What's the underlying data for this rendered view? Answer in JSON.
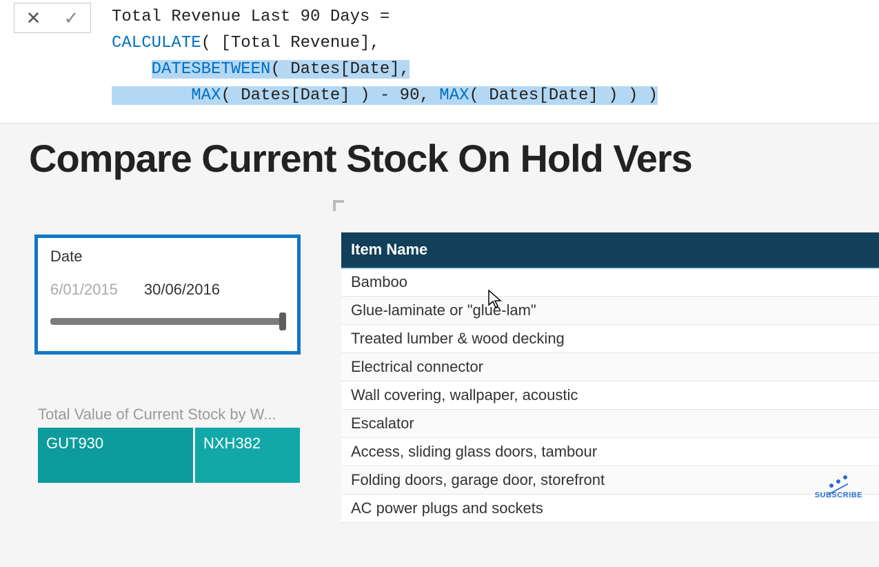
{
  "formula": {
    "line1_plain": "Total Revenue Last 90 Days =",
    "line2_fn": "CALCULATE",
    "line2_rest": "( [Total Revenue],",
    "line3_indent": "    ",
    "line3_fn": "DATESBETWEEN",
    "line3_rest": "( Dates[Date],",
    "line4_indent": "        ",
    "line4_max1": "MAX",
    "line4_mid": "( Dates[Date] ) - 90, ",
    "line4_max2": "MAX",
    "line4_end": "( Dates[Date] ) ) )"
  },
  "report_title": "Compare Current Stock On Hold Vers",
  "slicer": {
    "title": "Date",
    "start": "6/01/2015",
    "end": "30/06/2016"
  },
  "treemap": {
    "title": "Total Value of Current Stock by W...",
    "cells": [
      "GUT930",
      "NXH382"
    ]
  },
  "table": {
    "header": "Item Name",
    "rows": [
      "Bamboo",
      "Glue-laminate or \"glue-lam\"",
      "Treated lumber & wood decking",
      "Electrical connector",
      "Wall covering, wallpaper, acoustic",
      "Escalator",
      "Access, sliding glass doors, tambour",
      "Folding doors, garage door, storefront",
      "AC power plugs and sockets"
    ]
  },
  "subscribe_label": "SUBSCRIBE"
}
